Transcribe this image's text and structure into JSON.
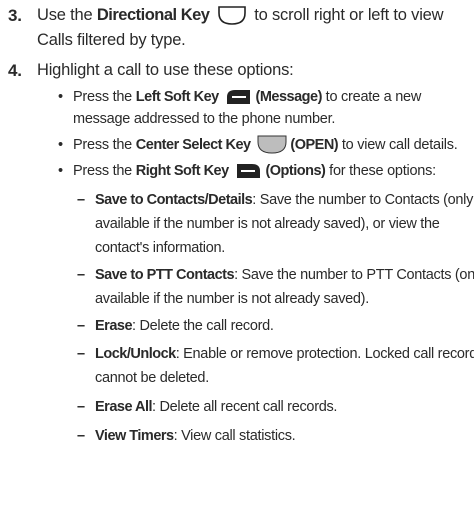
{
  "step3": {
    "number": "3.",
    "pre": "Use the ",
    "key": "Directional Key",
    "key_icon": "directional-key-icon",
    "post": " to scroll right or left to view",
    "line2": "Calls filtered by type."
  },
  "step4": {
    "number": "4.",
    "text": "Highlight a call to use these options:"
  },
  "bullets": [
    {
      "pre": "Press the ",
      "key": "Left Soft Key",
      "key_icon": "left-soft-key-icon",
      "label": "(Message)",
      "post": " to create a new",
      "line2": "message addressed to the phone number."
    },
    {
      "pre": "Press the ",
      "key": "Center Select Key",
      "key_icon": "center-select-key-icon",
      "label": "(OPEN)",
      "post": " to view call details."
    },
    {
      "pre": "Press the ",
      "key": "Right Soft Key",
      "key_icon": "right-soft-key-icon",
      "label": "(Options)",
      "post": " for these options:"
    }
  ],
  "bullet_glyph": "•",
  "dash_glyph": "–",
  "options": [
    {
      "term": "Save to Contacts/Details",
      "desc": ": Save the number to Contacts (only",
      "line2": "available if the number is not already saved), or view the",
      "line3": "contact's information."
    },
    {
      "term": "Save to PTT Contacts",
      "desc": ": Save the number to PTT Contacts (only",
      "line2": "available if the number is not already saved)."
    },
    {
      "term": "Erase",
      "desc": ": Delete the call record."
    },
    {
      "term": "Lock/Unlock",
      "desc": ": Enable or remove protection. Locked call records",
      "line2": "cannot be deleted."
    },
    {
      "term": "Erase All",
      "desc": ": Delete all recent call records."
    },
    {
      "term": "View Timers",
      "desc": ": View call statistics."
    }
  ]
}
